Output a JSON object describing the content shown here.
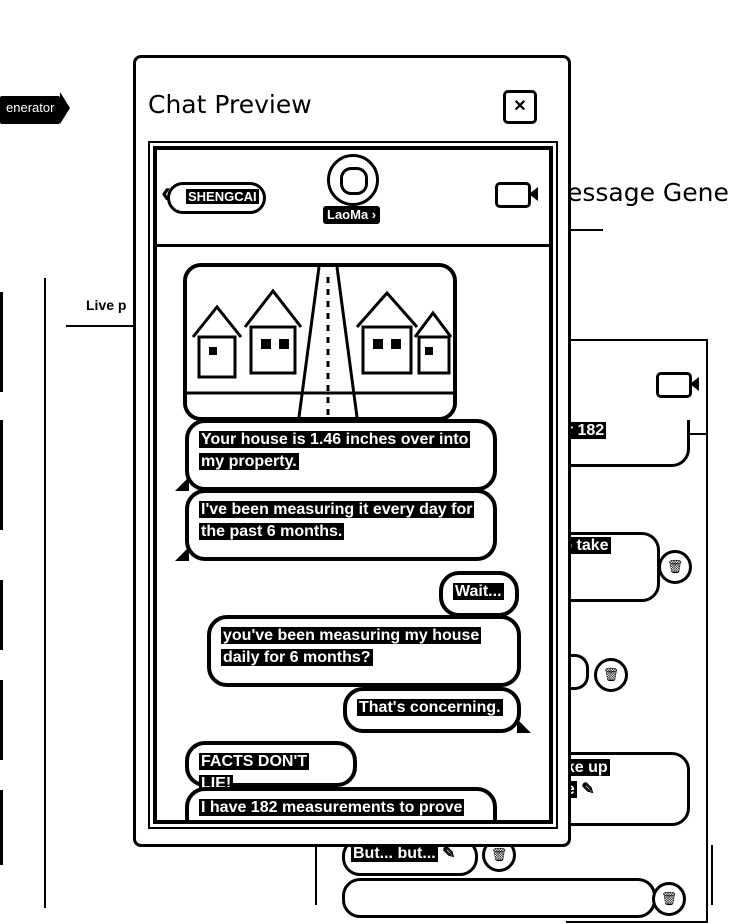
{
  "background": {
    "generator_tab": "enerator",
    "heading_partial": "lessage Gene",
    "live_label_partial": "Live p",
    "bubbles": [
      {
        "text": "to take"
      },
      {
        "text": "ake up"
      },
      {
        "text": "ce"
      },
      {
        "text": "But... but..."
      }
    ],
    "partial_top_text": "or 182"
  },
  "modal": {
    "title": "Chat Preview",
    "close_icon": "close-icon"
  },
  "phone": {
    "back_label": "SHENGCAI",
    "contact_name": "LaoMa",
    "video_icon": "video-camera-icon"
  },
  "messages": [
    {
      "side": "received",
      "text": "Your house is 1.46 inches over into my property."
    },
    {
      "side": "received",
      "text": "I've been measuring it every day for the past 6 months."
    },
    {
      "side": "sent",
      "text": "Wait..."
    },
    {
      "side": "sent",
      "text": "you've been measuring my house daily for 6 months?"
    },
    {
      "side": "sent",
      "text": "That's concerning."
    },
    {
      "side": "received",
      "text": "FACTS DON'T LIE!"
    },
    {
      "side": "received",
      "text": "I have 182 measurements to prove"
    }
  ]
}
